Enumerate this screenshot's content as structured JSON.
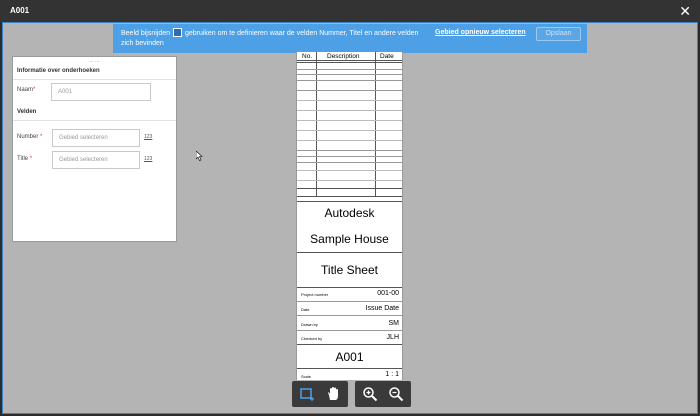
{
  "window": {
    "title": "A001"
  },
  "banner": {
    "message_part1": "Beeld bijsnijden",
    "message_part2": "gebruiken om te definieren waar de velden Nummer, Titel en andere velden zich bevinden",
    "reselect_link": "Gebied opnieuw selecteren",
    "save_button": "Opslaan"
  },
  "panel": {
    "heading": "Informatie over onderhoeken",
    "name_label": "Naam",
    "name_value": "A001",
    "fields_heading": "Velden",
    "number_label": "Number",
    "number_placeholder": "Gebied selecteren",
    "title_label": "Title",
    "title_placeholder": "Gebied selecteren",
    "required_mark": "*",
    "num_icon_label": "123"
  },
  "sheet": {
    "rev_headers": [
      "No.",
      "Description",
      "Date"
    ],
    "company": "Autodesk",
    "project": "Sample House",
    "sheet_name": "Title Sheet",
    "rows": [
      {
        "label": "Project number",
        "value": "001-00"
      },
      {
        "label": "Date",
        "value": "Issue Date"
      },
      {
        "label": "Drawn by",
        "value": "SM"
      },
      {
        "label": "Checked by",
        "value": "JLH"
      }
    ],
    "sheet_number": "A001",
    "scale_label": "Scale",
    "scale_value": "1 : 1"
  },
  "icons": {
    "crop": "crop-icon",
    "pan": "hand-icon",
    "zoom_in": "zoom-in-icon",
    "zoom_out": "zoom-out-icon",
    "close": "close-icon"
  },
  "colors": {
    "accent": "#4d9fe6",
    "required": "#dd3333"
  }
}
